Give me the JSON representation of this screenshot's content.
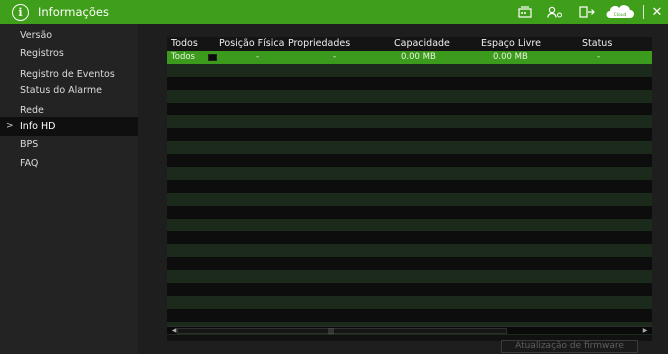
{
  "titlebar": {
    "title": "Informações",
    "icons": [
      "hdd-icon",
      "user-icon",
      "logout-icon",
      "cloud-icon",
      "close-icon"
    ],
    "cloud_label": "Cloud",
    "close_label": "✕",
    "accent_color": "#3f9f1a"
  },
  "sidebar": {
    "items": [
      {
        "label": "Versão"
      },
      {
        "label": "Registros"
      },
      {
        "label": "Registro de Eventos"
      },
      {
        "label": "Status do Alarme"
      },
      {
        "label": "Rede"
      },
      {
        "label": "Info HD",
        "active": true,
        "arrow": ">"
      },
      {
        "label": "BPS"
      },
      {
        "label": "FAQ"
      }
    ]
  },
  "table": {
    "columns": [
      "Todos",
      "Posição Física",
      "Propriedades",
      "Capacidade",
      "Espaço Livre",
      "Status"
    ],
    "rows": [
      {
        "todos": "Todos",
        "posicao": "-",
        "propriedades": "-",
        "capacidade": "0.00 MB",
        "espaco": "0.00 MB",
        "status": "-"
      }
    ]
  },
  "footer": {
    "firmware_button": "Atualização de firmware"
  }
}
